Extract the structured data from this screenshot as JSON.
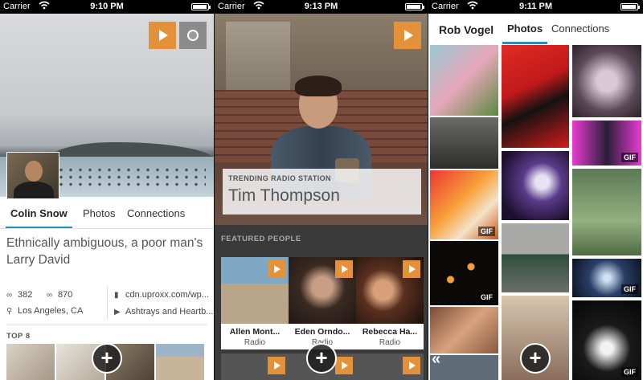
{
  "screens": [
    {
      "status": {
        "carrier": "Carrier",
        "time": "9:10 PM"
      },
      "profile": {
        "name": "Colin Snow",
        "tabs": [
          "Colin Snow",
          "Photos",
          "Connections"
        ],
        "bio": "Ethnically ambiguous, a poor man's Larry David",
        "followers": "382",
        "following": "870",
        "location": "Los Angeles, CA",
        "website": "cdn.uproxx.com/wp...",
        "station": "Ashtrays and Heartb...",
        "top_label": "TOP 8"
      },
      "icons": [
        "play-icon",
        "record-icon",
        "plus-icon"
      ]
    },
    {
      "status": {
        "carrier": "Carrier",
        "time": "9:13 PM"
      },
      "trending": {
        "kicker": "TRENDING RADIO STATION",
        "name": "Tim Thompson"
      },
      "featured_label": "FEATURED PEOPLE",
      "people": [
        {
          "name": "Allen Mont...",
          "sub": "Radio"
        },
        {
          "name": "Eden Orndo...",
          "sub": "Radio"
        },
        {
          "name": "Rebecca Ha...",
          "sub": "Radio"
        }
      ]
    },
    {
      "status": {
        "carrier": "Carrier",
        "time": "9:11 PM"
      },
      "header": {
        "name": "Rob Vogel",
        "tabs": [
          "Photos",
          "Connections"
        ]
      },
      "gif_label": "GIF",
      "back_glyph": "«"
    }
  ],
  "colors": {
    "accent": "#2a8fb8",
    "play": "#e3913a"
  }
}
